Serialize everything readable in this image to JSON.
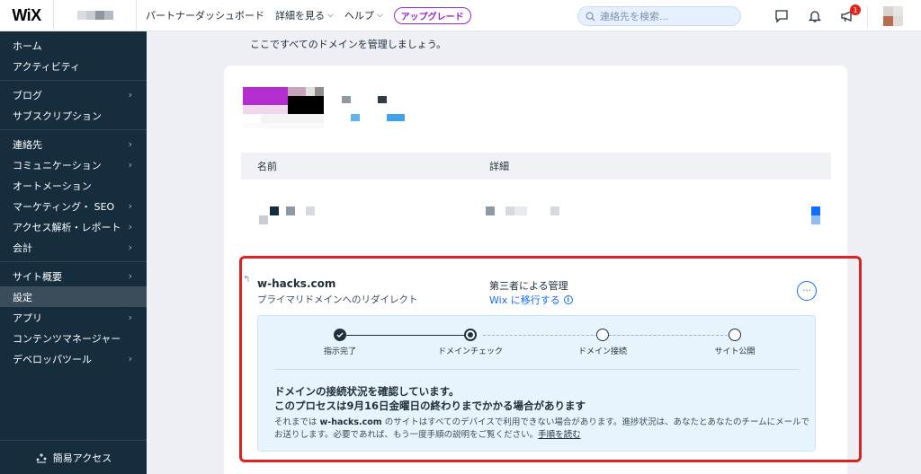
{
  "topbar": {
    "logo": "WiX",
    "nav": [
      {
        "label": "パートナーダッシュボード",
        "has_chevron": false
      },
      {
        "label": "詳細を見る",
        "has_chevron": true
      },
      {
        "label": "ヘルプ",
        "has_chevron": true
      }
    ],
    "upgrade_label": "アップグレード",
    "search_placeholder": "連絡先を検索...",
    "notification_count": "1",
    "icons": [
      "chat-icon",
      "bell-icon",
      "megaphone-icon"
    ]
  },
  "sidebar": {
    "groups": [
      [
        {
          "label": "ホーム",
          "arrow": false
        },
        {
          "label": "アクティビティ",
          "arrow": false
        }
      ],
      [
        {
          "label": "ブログ",
          "arrow": true
        },
        {
          "label": "サブスクリプション",
          "arrow": false
        }
      ],
      [
        {
          "label": "連絡先",
          "arrow": true
        },
        {
          "label": "コミュニケーション",
          "arrow": true
        },
        {
          "label": "オートメーション",
          "arrow": false
        },
        {
          "label": "マーケティング・ SEO",
          "arrow": true
        },
        {
          "label": "アクセス解析・レポート",
          "arrow": true
        },
        {
          "label": "会計",
          "arrow": true
        }
      ],
      [
        {
          "label": "サイト概要",
          "arrow": true
        },
        {
          "label": "設定",
          "arrow": false,
          "active": true
        },
        {
          "label": "アプリ",
          "arrow": true
        },
        {
          "label": "コンテンツマネージャー",
          "arrow": false
        },
        {
          "label": "デベロッパツール",
          "arrow": true
        }
      ]
    ],
    "footer_label": "簡易アクセス"
  },
  "main": {
    "intro": "ここですべてのドメインを管理しましょう。",
    "table_headers": {
      "name": "名前",
      "details": "詳細"
    }
  },
  "domain": {
    "name": "w-hacks.com",
    "subtitle": "プライマリドメインへのリダイレクト",
    "management": "第三者による管理",
    "transfer_link": "Wix に移行する",
    "more_label": "···",
    "steps": [
      {
        "label": "指示完了",
        "state": "done"
      },
      {
        "label": "ドメインチェック",
        "state": "current"
      },
      {
        "label": "ドメイン接続",
        "state": "pending"
      },
      {
        "label": "サイト公開",
        "state": "pending"
      }
    ],
    "status_title": "ドメインの接続状況を確認しています。",
    "status_subtitle": "このプロセスは9月16日金曜日の終わりまでかかる場合があります",
    "status_body_prefix": "それまでは ",
    "status_body_domain": "w-hacks.com",
    "status_body_mid": " のサイトはすべてのデバイスで利用できない場合があります。進捗状況は、あなたとあなたのチームにメールでお送りします。必要であれば、もう一度手順の説明をご覧ください。",
    "status_body_link": "手順を読む"
  },
  "colors": {
    "accent": "#116dff",
    "sidebar_bg": "#162d3d",
    "highlight": "#dc2222",
    "upgrade": "#9a27d5",
    "status_bg": "#e7f4fd"
  }
}
